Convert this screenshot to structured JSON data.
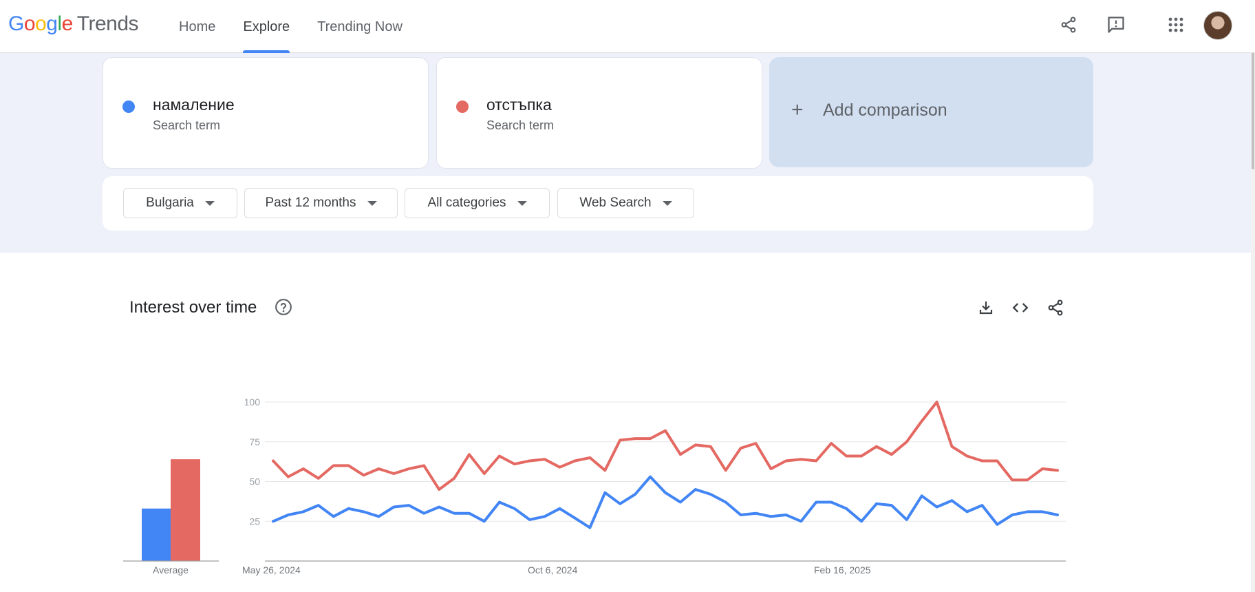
{
  "header": {
    "logo_text": "Trends",
    "nav": [
      {
        "label": "Home"
      },
      {
        "label": "Explore"
      },
      {
        "label": "Trending Now"
      }
    ]
  },
  "terms": [
    {
      "name": "намаление",
      "sub": "Search term",
      "color": "#4285f4"
    },
    {
      "name": "отстъпка",
      "sub": "Search term",
      "color": "#e46962"
    }
  ],
  "add_comparison": {
    "plus": "+",
    "label": "Add comparison"
  },
  "filters": [
    {
      "label": "Bulgaria"
    },
    {
      "label": "Past 12 months"
    },
    {
      "label": "All categories"
    },
    {
      "label": "Web Search"
    }
  ],
  "chart_card": {
    "title": "Interest over time"
  },
  "chart_data": {
    "type": "line",
    "title": "Interest over time",
    "x_tick_labels": [
      "May 26, 2024",
      "Oct 6, 2024",
      "Feb 16, 2025"
    ],
    "y_tick_labels": [
      "100",
      "75",
      "50",
      "25"
    ],
    "ylim": [
      0,
      100
    ],
    "grid": true,
    "average_label": "Average",
    "averages": [
      33,
      64
    ],
    "series": [
      {
        "name": "намаление",
        "color": "#4285f4",
        "values": [
          25,
          29,
          31,
          35,
          28,
          33,
          31,
          28,
          34,
          35,
          30,
          34,
          30,
          30,
          25,
          37,
          33,
          26,
          28,
          33,
          27,
          21,
          43,
          36,
          42,
          53,
          43,
          37,
          45,
          42,
          37,
          29,
          30,
          28,
          29,
          25,
          37,
          37,
          33,
          25,
          36,
          35,
          26,
          41,
          34,
          38,
          31,
          35,
          23,
          29,
          31,
          31,
          29
        ]
      },
      {
        "name": "отстъпка",
        "color": "#e46962",
        "values": [
          63,
          53,
          58,
          52,
          60,
          60,
          54,
          58,
          55,
          58,
          60,
          45,
          52,
          67,
          55,
          66,
          61,
          63,
          64,
          59,
          63,
          65,
          57,
          76,
          77,
          77,
          82,
          67,
          73,
          72,
          57,
          71,
          74,
          58,
          63,
          64,
          63,
          74,
          66,
          66,
          72,
          67,
          75,
          88,
          100,
          72,
          66,
          63,
          63,
          51,
          51,
          58,
          57
        ]
      }
    ]
  }
}
